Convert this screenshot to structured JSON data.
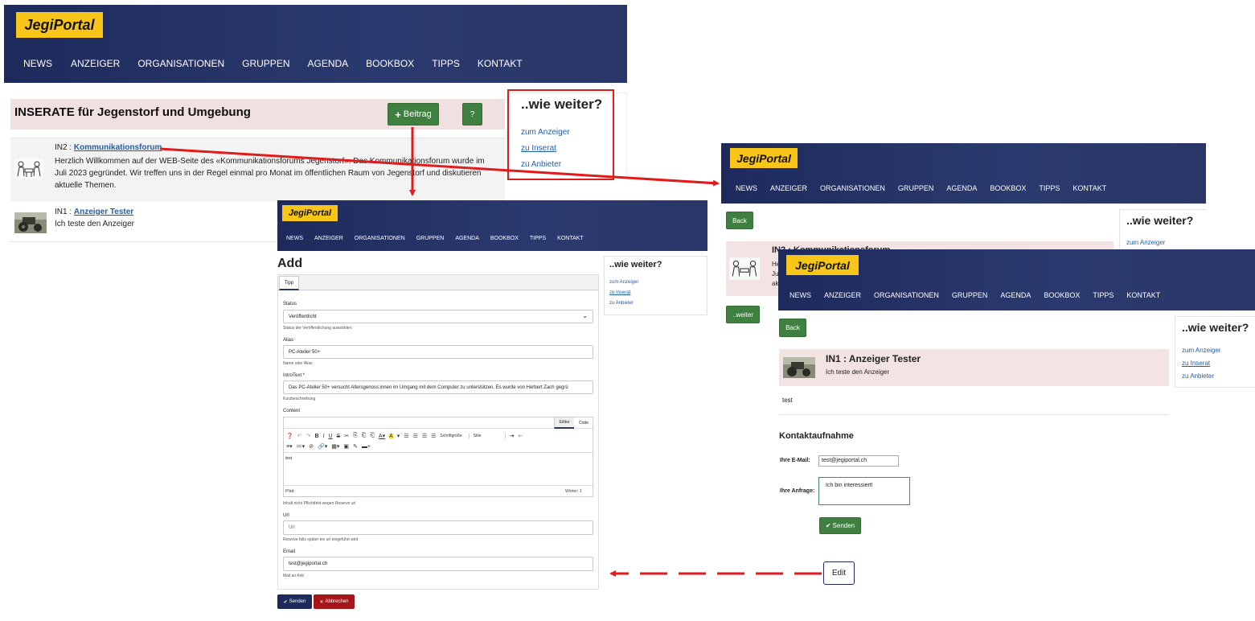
{
  "brand": "JegiPortal",
  "nav": [
    "NEWS",
    "ANZEIGER",
    "ORGANISATIONEN",
    "GRUPPEN",
    "AGENDA",
    "BOOKBOX",
    "TIPPS",
    "KONTAKT"
  ],
  "sidebar": {
    "title": "..wie weiter?",
    "links": [
      "zum Anzeiger",
      "zu Inserat",
      "zu Anbieter"
    ]
  },
  "list_page": {
    "title": "INSERATE für Jegenstorf und Umgebung",
    "add_button": "Beitrag",
    "help_button": "?",
    "items": [
      {
        "code": "IN2 : ",
        "title": "Kommunikationsforum",
        "text": "Herzlich Willkommen auf der WEB-Seite des «Kommunikationsforums Jegenstorf». Das Kommunikationsforum wurde im Juli 2023 gegründet. Wir treffen uns in der Regel einmal pro Monat im öffentlichen Raum von Jegenstorf und diskutieren aktuelle Themen."
      },
      {
        "code": "IN1 : ",
        "title": "Anzeiger Tester",
        "text": "Ich teste den Anzeiger"
      }
    ]
  },
  "add_form": {
    "heading": "Add",
    "tab": "Tipp",
    "status_label": "Status",
    "status_value": "Veröffentlicht",
    "status_hint": "Status der Veröffentlichung auswählen.",
    "alias_label": "Alias",
    "alias_value": "PC-Atelier 50+",
    "alias_hint": "Name oder Alias",
    "intro_label": "IntroText *",
    "intro_value": "Das PC-Atelier 50+ versucht Altersgenoss:innen im Umgang mit dem Computer zu unterstützen. Es wurde von Herbert Zach gegrü",
    "intro_hint": "Kurzbeschreibung",
    "content_label": "Content",
    "editor_tab": "Editor",
    "code_tab": "Code",
    "font_size": "Schriftgröße",
    "style": "Stile",
    "content_text": "test",
    "path_label": "Pfad:",
    "word_count": "Wörter: 1",
    "content_hint": "Inhalt nicht Pflichtfeld wegen Reserve url",
    "url_label": "Url",
    "url_placeholder": "Url",
    "url_hint": "Reserve falls später ein url eingeführt wird",
    "email_label": "Email",
    "email_value": "test@jegiportal.ch",
    "email_hint": "Mail an Anb",
    "submit": "Senden",
    "cancel": "Abbrechen"
  },
  "detail_back": {
    "back": "Back",
    "title_fragment": "IN2 : Kommunikationsforum",
    "text_fragment": [
      "He",
      "Ju",
      "ak"
    ],
    "weiter": "..weiter"
  },
  "detail_front": {
    "back": "Back",
    "item_title": "IN1 : Anzeiger Tester",
    "item_text": "Ich teste den Anzeiger",
    "body": "test",
    "contact_heading": "Kontaktaufnahme",
    "email_label": "Ihre E-Mail:",
    "email_value": "test@jegiportal.ch",
    "request_label": "Ihre Anfrage:",
    "request_value": "Ich bin interessiert!",
    "send": "Senden"
  },
  "edit_label": "Edit",
  "colors": {
    "banner": "#243167",
    "logo": "#f7c619",
    "green": "#3f7f3f",
    "red_arrow": "#e01b1b"
  }
}
